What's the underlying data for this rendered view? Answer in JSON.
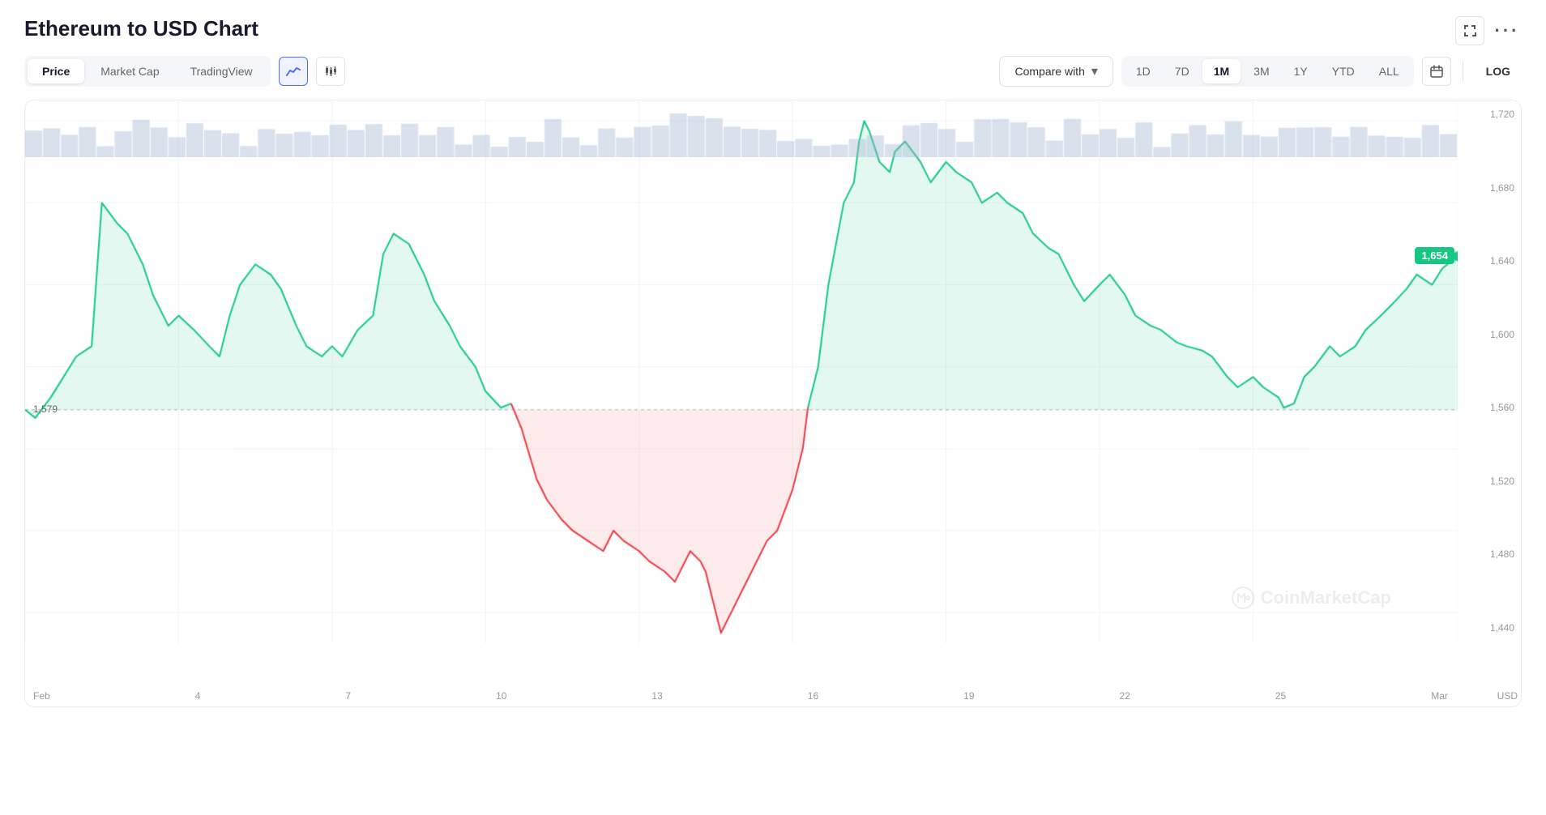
{
  "page": {
    "title": "Ethereum to USD Chart"
  },
  "toolbar": {
    "tabs": [
      {
        "id": "price",
        "label": "Price",
        "active": true
      },
      {
        "id": "market-cap",
        "label": "Market Cap",
        "active": false
      },
      {
        "id": "trading-view",
        "label": "TradingView",
        "active": false
      }
    ],
    "chart_type_line": "line-icon",
    "chart_type_candle": "candle-icon",
    "compare_with": "Compare with",
    "compare_chevron": "▾",
    "time_periods": [
      {
        "id": "1d",
        "label": "1D",
        "active": false
      },
      {
        "id": "7d",
        "label": "7D",
        "active": false
      },
      {
        "id": "1m",
        "label": "1M",
        "active": true
      },
      {
        "id": "3m",
        "label": "3M",
        "active": false
      },
      {
        "id": "1y",
        "label": "1Y",
        "active": false
      },
      {
        "id": "ytd",
        "label": "YTD",
        "active": false
      },
      {
        "id": "all",
        "label": "ALL",
        "active": false
      }
    ],
    "log_label": "LOG",
    "calendar_icon": "calendar-icon",
    "fullscreen_icon": "fullscreen-icon",
    "more_icon": "more-icon"
  },
  "chart": {
    "y_labels": [
      "1,720",
      "1,680",
      "1,640",
      "1,600",
      "1,560",
      "1,520",
      "1,480",
      "1,440"
    ],
    "x_labels": [
      "Feb",
      "4",
      "7",
      "10",
      "13",
      "16",
      "19",
      "22",
      "25",
      "Mar"
    ],
    "current_price": "1,654",
    "open_price": "1,579",
    "watermark": "CoinMarketCap",
    "usd_label": "USD",
    "accent_green": "#16c784",
    "accent_red": "#ea3943",
    "fill_green": "rgba(22,199,132,0.12)",
    "fill_red": "rgba(234,57,67,0.1)"
  }
}
